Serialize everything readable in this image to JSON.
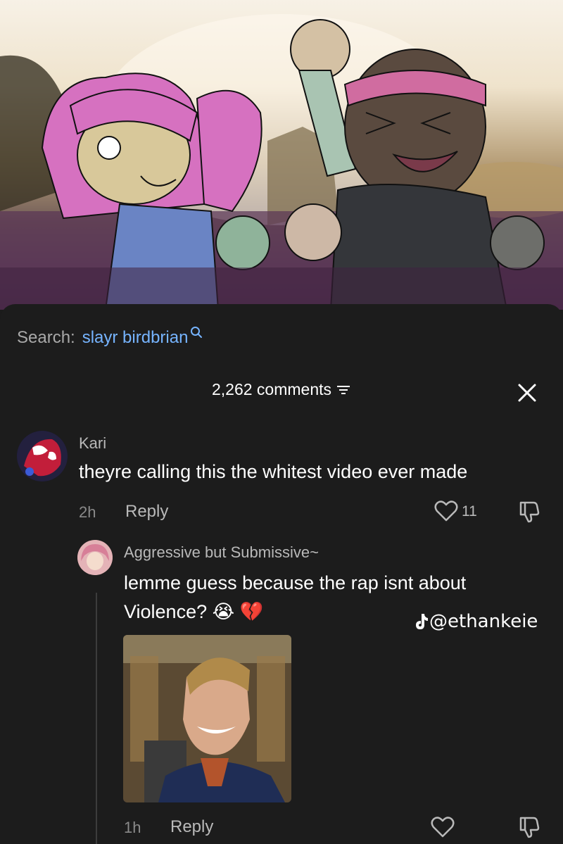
{
  "search": {
    "prefix": "Search:",
    "term": "slayr birdbrian"
  },
  "comments_header": {
    "count_label": "2,262 comments"
  },
  "comments": [
    {
      "username": "Kari",
      "text": "theyre calling this the whitest video ever made",
      "time": "2h",
      "reply_label": "Reply",
      "likes": "11",
      "avatar_icon": "spider-man-avatar"
    }
  ],
  "reply": {
    "username": "Aggressive but Submissive~",
    "text_line1": "lemme guess because the rap isnt about",
    "text_line2": "Violence? 😭 💔",
    "time": "1h",
    "reply_label": "Reply",
    "attachment": "homelander-laughing-image"
  },
  "watermark": {
    "handle": "@ethankeie",
    "icon": "tiktok-icon"
  },
  "colors": {
    "link_blue": "#76b4ff",
    "sheet_bg": "#1c1c1c"
  }
}
